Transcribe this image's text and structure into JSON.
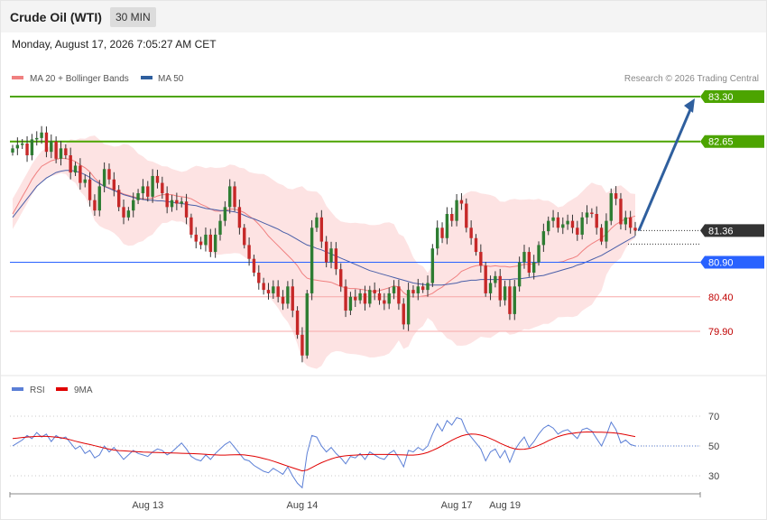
{
  "header": {
    "instrument": "Crude Oil (WTI)",
    "timeframe": "30 MIN",
    "datetime": "Monday, August 17, 2026 7:05:27 AM CET"
  },
  "legend": {
    "ma20_label": "MA 20 + Bollinger Bands",
    "ma50_label": "MA 50",
    "credit": "Research © 2026 Trading Central",
    "rsi_label": "RSI",
    "ma9_label": "9MA"
  },
  "colors": {
    "up": "#2e7d32",
    "down": "#c62828",
    "band": "#fde3e3",
    "ma20": "#f08080",
    "ma50": "#4a5fa8",
    "resistance": "#4ca400",
    "pivot": "#2962ff",
    "support": "#f7a8a8",
    "arrow": "#2f5f9e",
    "rsi": "#5b7fd6",
    "rsi_ma": "#e00000"
  },
  "chart_data": [
    {
      "type": "candlestick",
      "xlabels": [
        "Aug 13",
        "Aug 14",
        "Aug 17",
        "Aug 19"
      ],
      "ylim": [
        79.12,
        83.52
      ],
      "price_levels": [
        {
          "label": "83.30",
          "value": 83.3,
          "kind": "resistance"
        },
        {
          "label": "82.65",
          "value": 82.65,
          "kind": "resistance"
        },
        {
          "label": "81.36",
          "value": 81.36,
          "kind": "last"
        },
        {
          "label": "80.90",
          "value": 80.9,
          "kind": "pivot"
        },
        {
          "label": "80.40",
          "value": 80.4,
          "kind": "support"
        },
        {
          "label": "79.90",
          "value": 79.9,
          "kind": "support"
        }
      ],
      "projection": {
        "from": 81.36,
        "to": 83.3
      },
      "closes": [
        82.55,
        82.6,
        82.62,
        82.45,
        82.68,
        82.7,
        82.78,
        82.5,
        82.65,
        82.4,
        82.55,
        82.45,
        82.2,
        82.3,
        82.05,
        82.1,
        81.8,
        81.65,
        82.0,
        82.25,
        82.1,
        81.95,
        81.7,
        81.55,
        81.65,
        81.8,
        81.9,
        82.0,
        81.85,
        82.15,
        82.05,
        81.9,
        81.7,
        81.8,
        81.75,
        81.78,
        81.55,
        81.3,
        81.2,
        81.15,
        81.3,
        81.05,
        81.3,
        81.5,
        81.7,
        82.0,
        81.7,
        81.4,
        81.15,
        80.95,
        80.75,
        80.6,
        80.5,
        80.45,
        80.55,
        80.4,
        80.3,
        80.55,
        80.2,
        79.85,
        79.55,
        80.45,
        81.4,
        81.55,
        81.2,
        80.9,
        81.1,
        80.8,
        80.55,
        80.2,
        80.4,
        80.35,
        80.45,
        80.3,
        80.5,
        80.45,
        80.35,
        80.3,
        80.45,
        80.55,
        80.3,
        80.0,
        80.5,
        80.45,
        80.55,
        80.5,
        80.6,
        81.1,
        81.4,
        81.25,
        81.6,
        81.5,
        81.8,
        81.75,
        81.4,
        81.25,
        81.05,
        80.85,
        80.45,
        80.6,
        80.7,
        80.35,
        80.55,
        80.15,
        80.55,
        80.9,
        81.05,
        80.75,
        80.9,
        81.15,
        81.35,
        81.5,
        81.55,
        81.4,
        81.45,
        81.5,
        81.4,
        81.3,
        81.55,
        81.62,
        81.6,
        81.4,
        81.2,
        81.5,
        81.9,
        81.82,
        81.45,
        81.55,
        81.4,
        81.36
      ],
      "ma20_values": [
        81.6,
        81.72,
        81.85,
        81.97,
        82.1,
        82.2,
        82.29,
        82.33,
        82.37,
        82.39,
        82.41,
        82.4,
        82.39,
        82.36,
        82.31,
        82.27,
        82.21,
        82.12,
        82.05,
        82.0,
        81.98,
        81.95,
        81.92,
        81.89,
        81.87,
        81.85,
        81.83,
        81.82,
        81.82,
        81.83,
        81.86,
        81.88,
        81.88,
        81.88,
        81.86,
        81.85,
        81.84,
        81.82,
        81.78,
        81.74,
        81.71,
        81.67,
        81.64,
        81.64,
        81.65,
        81.67,
        81.67,
        81.65,
        81.62,
        81.57,
        81.52,
        81.45,
        81.37,
        81.28,
        81.21,
        81.14,
        81.07,
        81.0,
        80.93,
        80.85,
        80.74,
        80.67,
        80.65,
        80.64,
        80.63,
        80.62,
        80.61,
        80.58,
        80.55,
        80.53,
        80.52,
        80.52,
        80.51,
        80.5,
        80.48,
        80.48,
        80.49,
        80.51,
        80.53,
        80.56,
        80.54,
        80.46,
        80.41,
        80.4,
        80.4,
        80.41,
        80.42,
        80.45,
        80.5,
        80.54,
        80.6,
        80.65,
        80.7,
        80.77,
        80.8,
        80.83,
        80.85,
        80.86,
        80.85,
        80.84,
        80.85,
        80.84,
        80.84,
        80.83,
        80.84,
        80.85,
        80.87,
        80.87,
        80.88,
        80.9,
        80.9,
        80.9,
        80.9,
        80.9,
        80.91,
        80.94,
        80.96,
        80.99,
        81.06,
        81.12,
        81.17,
        81.21,
        81.25,
        81.31,
        81.39,
        81.45,
        81.49,
        81.53,
        81.55,
        81.57
      ],
      "ma50_values": [
        81.55,
        81.64,
        81.73,
        81.82,
        81.91,
        82.0,
        82.06,
        82.12,
        82.16,
        82.2,
        82.22,
        82.23,
        82.23,
        82.22,
        82.2,
        82.17,
        82.13,
        82.08,
        82.04,
        82.0,
        81.97,
        81.94,
        81.91,
        81.88,
        81.86,
        81.84,
        81.82,
        81.81,
        81.8,
        81.8,
        81.79,
        81.79,
        81.78,
        81.77,
        81.76,
        81.75,
        81.74,
        81.73,
        81.72,
        81.7,
        81.68,
        81.67,
        81.66,
        81.65,
        81.65,
        81.64,
        81.63,
        81.61,
        81.58,
        81.55,
        81.53,
        81.5,
        81.47,
        81.44,
        81.41,
        81.38,
        81.34,
        81.31,
        81.27,
        81.23,
        81.19,
        81.15,
        81.13,
        81.1,
        81.08,
        81.05,
        81.02,
        80.99,
        80.96,
        80.93,
        80.9,
        80.87,
        80.84,
        80.81,
        80.78,
        80.76,
        80.74,
        80.72,
        80.7,
        80.68,
        80.66,
        80.64,
        80.62,
        80.6,
        80.59,
        80.58,
        80.57,
        80.57,
        80.57,
        80.57,
        80.58,
        80.59,
        80.6,
        80.62,
        80.63,
        80.64,
        80.64,
        80.65,
        80.65,
        80.65,
        80.65,
        80.65,
        80.65,
        80.65,
        80.66,
        80.66,
        80.67,
        80.68,
        80.69,
        80.7,
        80.71,
        80.73,
        80.75,
        80.77,
        80.79,
        80.81,
        80.83,
        80.86,
        80.88,
        80.91,
        80.94,
        80.97,
        81.0,
        81.04,
        81.08,
        81.12,
        81.16,
        81.2,
        81.24,
        81.28
      ]
    },
    {
      "type": "line",
      "name": "RSI",
      "ylim": [
        18,
        78
      ],
      "ticks": [
        70,
        50,
        30
      ],
      "rsi_values": [
        50,
        52,
        54,
        57,
        55,
        59,
        56,
        58,
        53,
        57,
        55,
        56,
        52,
        48,
        50,
        45,
        47,
        42,
        44,
        50,
        46,
        49,
        45,
        41,
        44,
        47,
        45,
        44,
        43,
        46,
        48,
        47,
        44,
        46,
        49,
        52,
        48,
        43,
        41,
        40,
        44,
        41,
        45,
        48,
        51,
        53,
        49,
        45,
        41,
        40,
        37,
        35,
        33,
        32,
        35,
        33,
        31,
        36,
        30,
        25,
        22,
        45,
        57,
        56,
        50,
        46,
        49,
        45,
        42,
        38,
        43,
        42,
        45,
        41,
        46,
        44,
        42,
        41,
        45,
        47,
        42,
        36,
        47,
        46,
        49,
        47,
        50,
        58,
        65,
        60,
        67,
        64,
        69,
        68,
        60,
        56,
        52,
        48,
        40,
        46,
        48,
        42,
        47,
        39,
        47,
        52,
        56,
        49,
        53,
        58,
        62,
        64,
        62,
        58,
        60,
        61,
        58,
        55,
        61,
        62,
        60,
        55,
        50,
        57,
        66,
        61,
        52,
        54,
        51,
        50
      ],
      "rsi_ma_values": [
        55,
        55.3,
        55.7,
        56.0,
        56.2,
        56.4,
        56.5,
        56.4,
        56.2,
        55.9,
        55.5,
        54.9,
        54.1,
        53.2,
        52.4,
        51.7,
        51.0,
        50.2,
        49.4,
        48.6,
        47.9,
        47.3,
        46.9,
        46.7,
        46.5,
        46.3,
        46.1,
        45.9,
        45.8,
        45.7,
        45.6,
        45.5,
        45.4,
        45.3,
        45.2,
        45.1,
        45.0,
        44.9,
        44.8,
        44.6,
        44.4,
        44.2,
        44.0,
        43.9,
        43.9,
        44.0,
        44.1,
        44.2,
        44.0,
        43.6,
        43.1,
        42.4,
        41.6,
        40.8,
        39.8,
        38.7,
        37.6,
        36.5,
        35.4,
        34.3,
        33.3,
        33.8,
        35.5,
        37.2,
        38.8,
        40.1,
        41.3,
        42.3,
        43.0,
        43.4,
        43.7,
        43.9,
        44.1,
        44.2,
        44.3,
        44.3,
        44.3,
        44.3,
        44.3,
        44.2,
        44.1,
        44.0,
        43.9,
        43.9,
        44.2,
        44.8,
        45.7,
        47.0,
        48.5,
        50.2,
        52.0,
        53.8,
        55.4,
        56.7,
        57.6,
        58.0,
        57.9,
        57.3,
        56.3,
        55.0,
        53.5,
        51.9,
        50.4,
        49.1,
        48.1,
        47.7,
        47.8,
        48.3,
        49.2,
        50.4,
        51.9,
        53.5,
        55.0,
        56.3,
        57.3,
        58.0,
        58.5,
        58.9,
        59.2,
        59.4,
        59.4,
        59.3,
        59.2,
        59.1,
        58.9,
        58.6,
        58.2,
        57.6,
        56.9,
        56.3
      ]
    }
  ]
}
